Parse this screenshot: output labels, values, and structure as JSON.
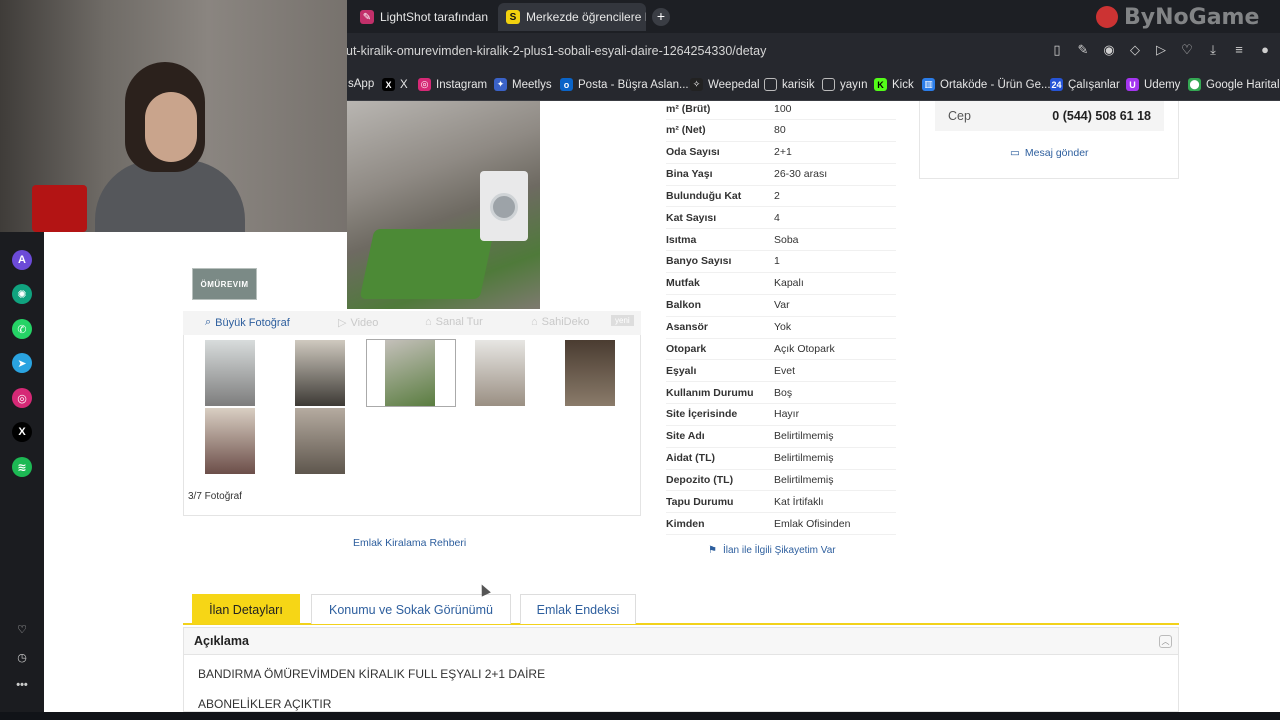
{
  "browser": {
    "tabs": [
      {
        "label": "LightShot tarafından Ekran",
        "icon": "feather-icon"
      },
      {
        "label": "Merkezde öğrencilere Eşy",
        "icon": "s-icon"
      }
    ],
    "watermark": "ByNoGame",
    "url": "ut-kiralik-omurevimden-kiralik-2-plus1-sobali-esyali-daire-1264254330/detay",
    "bookmarks": [
      "sApp",
      "X",
      "Instagram",
      "Meetlys",
      "Posta - Büşra Aslan...",
      "Weepedal",
      "karisik",
      "yayın",
      "Kick",
      "Ortaköde - Ürün Ge...",
      "Çalışanlar",
      "Udemy",
      "Google Haritalar"
    ]
  },
  "gallery": {
    "logo_text": "ÖMÜREVIM",
    "buttons": {
      "big_photo": "Büyük Fotoğraf",
      "video": "Video",
      "virtual_tour": "Sanal Tur",
      "owner": "SahiDeko",
      "new": "yeni"
    },
    "counter": "3/7 Fotoğraf"
  },
  "guide_link": "Emlak Kiralama Rehberi",
  "specs": [
    {
      "k": "m² (Brüt)",
      "v": "100"
    },
    {
      "k": "m² (Net)",
      "v": "80"
    },
    {
      "k": "Oda Sayısı",
      "v": "2+1"
    },
    {
      "k": "Bina Yaşı",
      "v": "26-30 arası"
    },
    {
      "k": "Bulunduğu Kat",
      "v": "2"
    },
    {
      "k": "Kat Sayısı",
      "v": "4"
    },
    {
      "k": "Isıtma",
      "v": "Soba"
    },
    {
      "k": "Banyo Sayısı",
      "v": "1"
    },
    {
      "k": "Mutfak",
      "v": "Kapalı"
    },
    {
      "k": "Balkon",
      "v": "Var"
    },
    {
      "k": "Asansör",
      "v": "Yok"
    },
    {
      "k": "Otopark",
      "v": "Açık Otopark"
    },
    {
      "k": "Eşyalı",
      "v": "Evet"
    },
    {
      "k": "Kullanım Durumu",
      "v": "Boş"
    },
    {
      "k": "Site İçerisinde",
      "v": "Hayır"
    },
    {
      "k": "Site Adı",
      "v": "Belirtilmemiş"
    },
    {
      "k": "Aidat (TL)",
      "v": "Belirtilmemiş"
    },
    {
      "k": "Depozito (TL)",
      "v": "Belirtilmemiş"
    },
    {
      "k": "Tapu Durumu",
      "v": "Kat İrtifaklı"
    },
    {
      "k": "Kimden",
      "v": "Emlak Ofisinden"
    }
  ],
  "complaint_link": "İlan ile İlgili Şikayetim Var",
  "contact": {
    "label": "Cep",
    "phone": "0 (544) 508 61 18",
    "message": "Mesaj gönder"
  },
  "tabs": [
    {
      "label": "İlan Detayları"
    },
    {
      "label": "Konumu ve Sokak Görünümü"
    },
    {
      "label": "Emlak Endeksi"
    }
  ],
  "description": {
    "heading": "Açıklama",
    "line1": "BANDIRMA ÖMÜREVİMDEN KİRALIK FULL EŞYALI 2+1 DAİRE",
    "line2": "ABONELİKLER AÇIKTIR"
  },
  "colors": {
    "accent": "#f6d616",
    "link": "#2e5f9e"
  }
}
